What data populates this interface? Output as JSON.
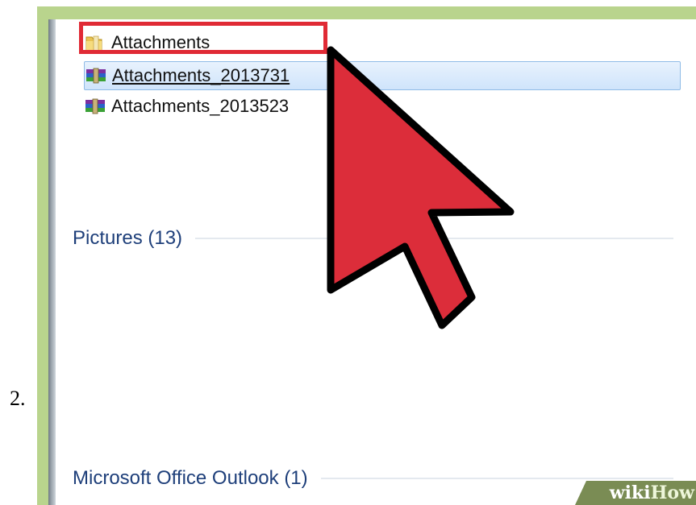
{
  "step": {
    "number": "2."
  },
  "files": [
    {
      "name": "Attachments",
      "type": "folder",
      "icon": "folder-icon",
      "selected": false
    },
    {
      "name": "Attachments_2013731",
      "type": "archive",
      "icon": "winrar-archive-icon",
      "selected": true
    },
    {
      "name": "Attachments_2013523",
      "type": "archive",
      "icon": "winrar-archive-icon",
      "selected": false
    }
  ],
  "groups": {
    "pictures": "Pictures (13)",
    "outlook": "Microsoft Office Outlook (1)"
  },
  "watermark": {
    "wiki": "wiki",
    "how": "How"
  },
  "colors": {
    "highlight_box": "#e02a35",
    "cursor_fill": "#dc2d3a",
    "group_header_text": "#1e3f7a",
    "selection_border": "#8fbbe6",
    "frame": "#b9d48d"
  }
}
